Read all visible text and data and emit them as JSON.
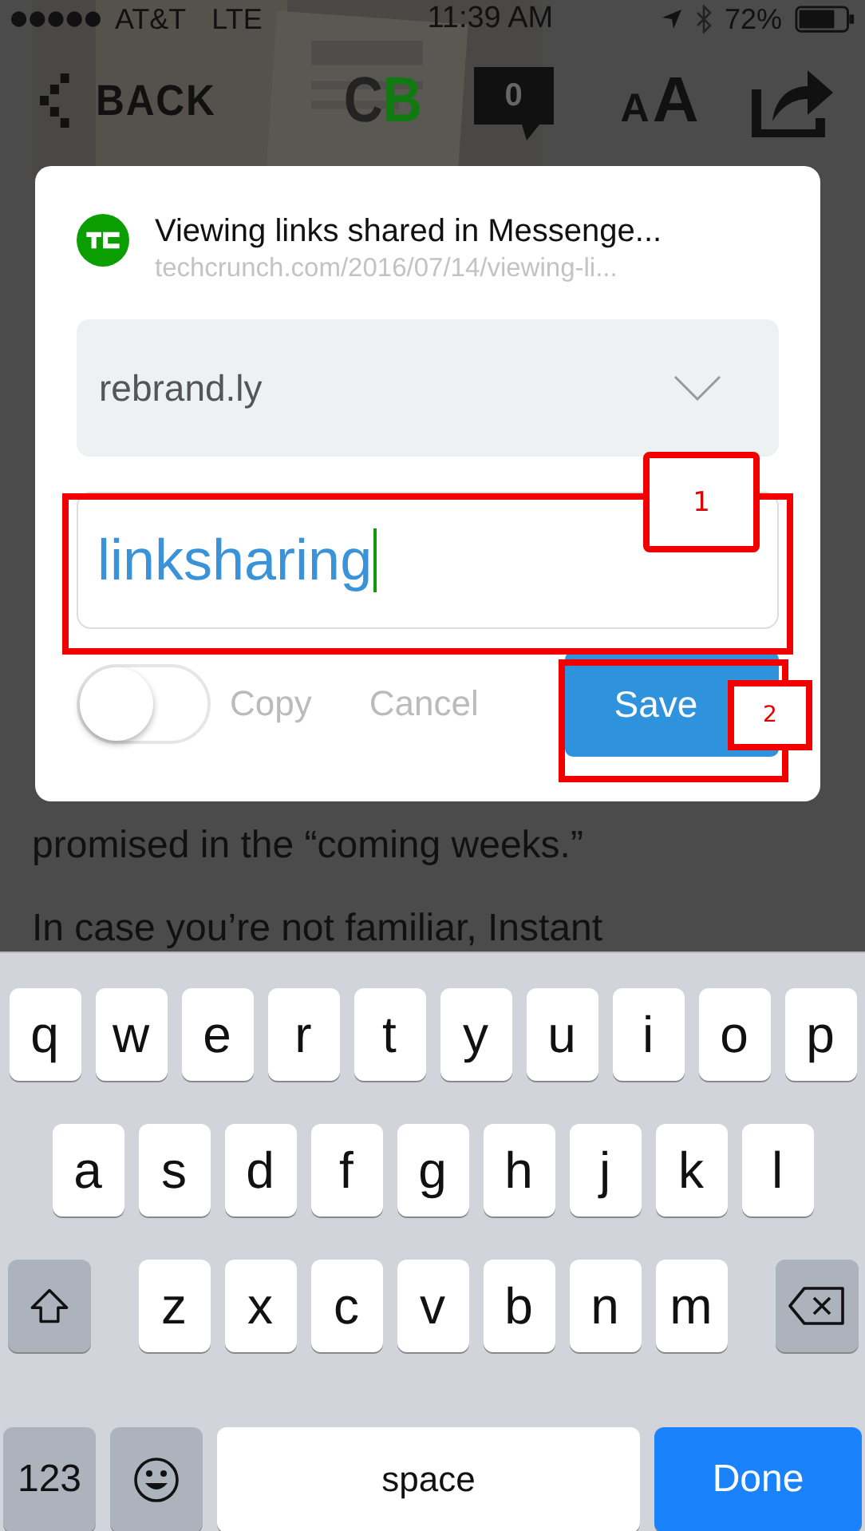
{
  "status_bar": {
    "carrier": "AT&T",
    "network": "LTE",
    "time": "11:39 AM",
    "battery": "72%"
  },
  "nav": {
    "back": "BACK",
    "logo": [
      "C",
      "B"
    ],
    "comments": "0",
    "text_size": [
      "A",
      "A"
    ]
  },
  "article": [
    "promised in the “coming weeks.”",
    "In case you’re not familiar, Instant"
  ],
  "dialog": {
    "title": "Viewing links shared in Messenge...",
    "url": "techcrunch.com/2016/07/14/viewing-li...",
    "domain": "rebrand.ly",
    "slug": "linksharing",
    "copy_toggle": {
      "label": "Copy",
      "on": false
    },
    "cancel": "Cancel",
    "save": "Save"
  },
  "annotations": [
    {
      "label": "1"
    },
    {
      "label": "2"
    }
  ],
  "keyboard": {
    "rows": [
      [
        "q",
        "w",
        "e",
        "r",
        "t",
        "y",
        "u",
        "i",
        "o",
        "p"
      ],
      [
        "a",
        "s",
        "d",
        "f",
        "g",
        "h",
        "j",
        "k",
        "l"
      ],
      [
        "z",
        "x",
        "c",
        "v",
        "b",
        "n",
        "m"
      ]
    ],
    "numbers": "123",
    "space": "space",
    "done": "Done"
  }
}
